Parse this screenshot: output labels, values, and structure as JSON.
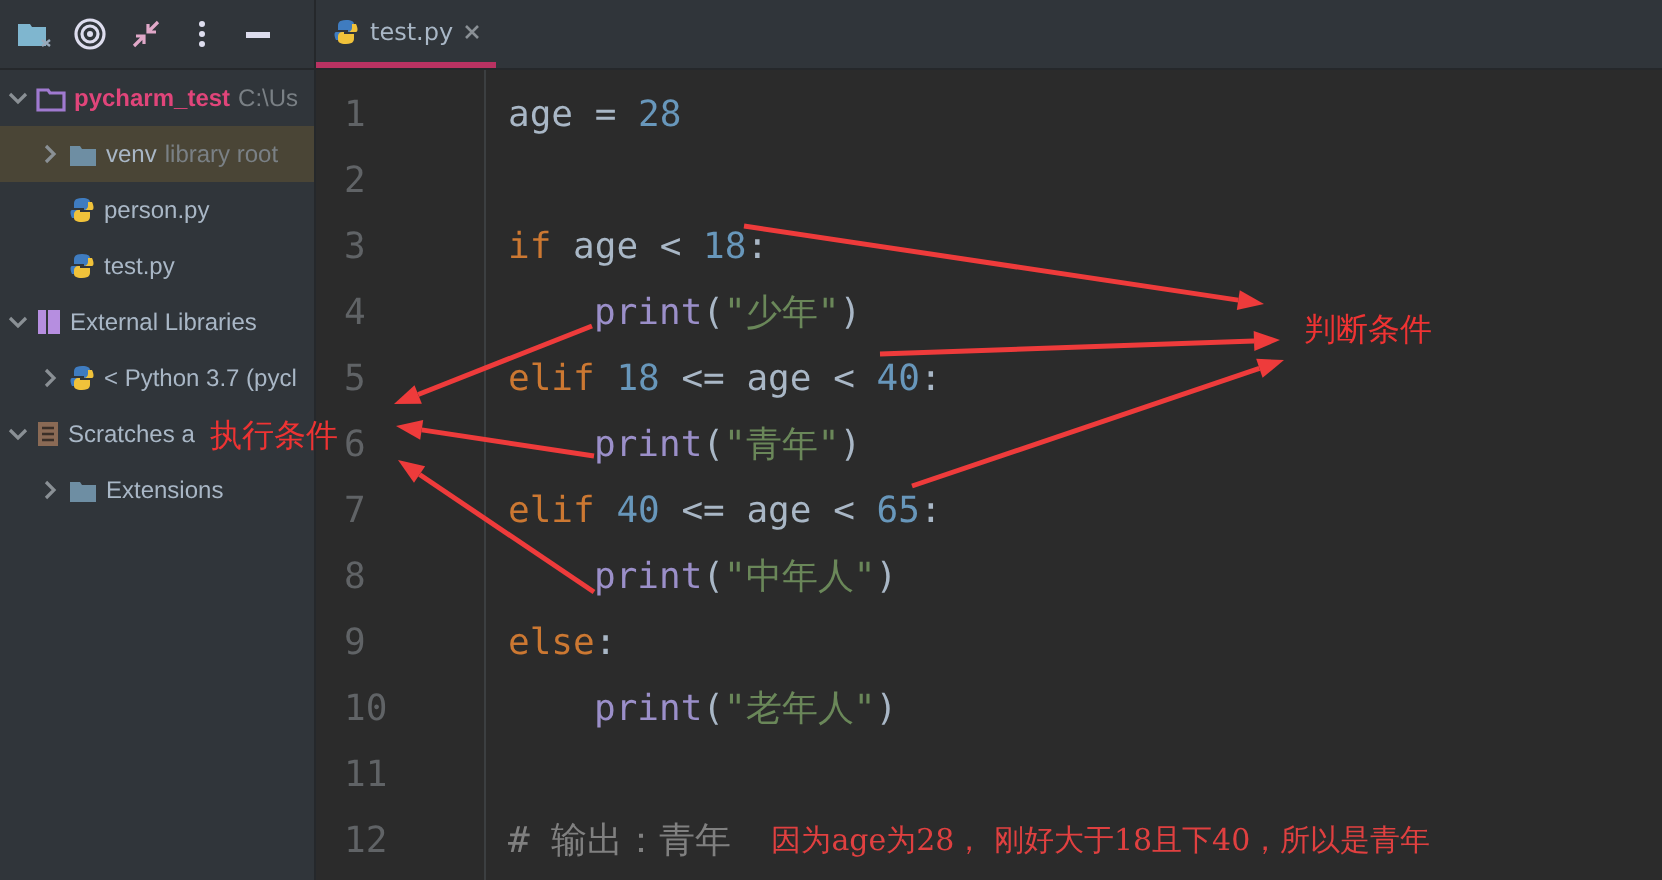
{
  "project_panel": {
    "tree": [
      {
        "label": "pycharm_test",
        "hint": "C:\\Us",
        "kind": "project",
        "expanded": true,
        "selected": false,
        "children": [
          {
            "label": "venv",
            "hint": "library root",
            "kind": "folder",
            "expanded": false,
            "selected": true
          },
          {
            "label": "person.py",
            "kind": "python",
            "selected": false
          },
          {
            "label": "test.py",
            "kind": "python",
            "selected": false
          }
        ]
      },
      {
        "label": "External Libraries",
        "kind": "library",
        "expanded": true,
        "selected": false,
        "children": [
          {
            "label": "< Python 3.7 (pycl",
            "kind": "python",
            "expanded": false,
            "selected": false
          }
        ]
      },
      {
        "label": "Scratches a",
        "kind": "scratches",
        "expanded": true,
        "selected": false,
        "children": [
          {
            "label": "Extensions",
            "kind": "folder",
            "expanded": false,
            "selected": false
          }
        ]
      }
    ]
  },
  "tabs": [
    {
      "label": "test.py",
      "selected": true
    }
  ],
  "editor": {
    "lines": [
      {
        "number": "1",
        "tokens": [
          {
            "kind": "plain",
            "text": "age = "
          },
          {
            "kind": "number",
            "text": "28"
          }
        ]
      },
      {
        "number": "2"
      },
      {
        "number": "3",
        "tokens": [
          {
            "kind": "keyword",
            "text": "if"
          },
          {
            "kind": "plain",
            "text": " age < "
          },
          {
            "kind": "number",
            "text": "18"
          },
          {
            "kind": "plain",
            "text": ":"
          }
        ]
      },
      {
        "number": "4",
        "indented": true,
        "tokens": [
          {
            "kind": "builtin",
            "text": "print"
          },
          {
            "kind": "plain",
            "text": "("
          },
          {
            "kind": "string",
            "text": "\"少年\""
          },
          {
            "kind": "plain",
            "text": ")"
          }
        ]
      },
      {
        "number": "5",
        "tokens": [
          {
            "kind": "keyword",
            "text": "elif "
          },
          {
            "kind": "number",
            "text": "18"
          },
          {
            "kind": "plain",
            "text": " <= age < "
          },
          {
            "kind": "number",
            "text": "40"
          },
          {
            "kind": "plain",
            "text": ":"
          }
        ]
      },
      {
        "number": "6",
        "indented": true,
        "tokens": [
          {
            "kind": "builtin",
            "text": "print"
          },
          {
            "kind": "plain",
            "text": "("
          },
          {
            "kind": "string",
            "text": "\"青年\""
          },
          {
            "kind": "plain",
            "text": ")"
          }
        ]
      },
      {
        "number": "7",
        "tokens": [
          {
            "kind": "keyword",
            "text": "elif "
          },
          {
            "kind": "number",
            "text": "40"
          },
          {
            "kind": "plain",
            "text": " <= age < "
          },
          {
            "kind": "number",
            "text": "65"
          },
          {
            "kind": "plain",
            "text": ":"
          }
        ]
      },
      {
        "number": "8",
        "indented": true,
        "tokens": [
          {
            "kind": "builtin",
            "text": "print"
          },
          {
            "kind": "plain",
            "text": "("
          },
          {
            "kind": "string",
            "text": "\"中年人\""
          },
          {
            "kind": "plain",
            "text": ")"
          }
        ]
      },
      {
        "number": "9",
        "tokens": [
          {
            "kind": "keyword",
            "text": "else"
          },
          {
            "kind": "plain",
            "text": ":"
          }
        ]
      },
      {
        "number": "10",
        "indented": true,
        "tokens": [
          {
            "kind": "builtin",
            "text": "print"
          },
          {
            "kind": "plain",
            "text": "("
          },
          {
            "kind": "string",
            "text": "\"老年人\""
          },
          {
            "kind": "plain",
            "text": ")"
          }
        ]
      },
      {
        "number": "11"
      },
      {
        "number": "12",
        "tokens": [
          {
            "kind": "comment",
            "text": "# 输出：青年"
          },
          {
            "kind": "note",
            "text": "因为age为28， 刚好大于18且下40，所以是青年"
          }
        ]
      }
    ]
  },
  "annotations": [
    {
      "kind": "condition",
      "text": "判断条件"
    },
    {
      "kind": "action",
      "text": "执行条件"
    }
  ]
}
